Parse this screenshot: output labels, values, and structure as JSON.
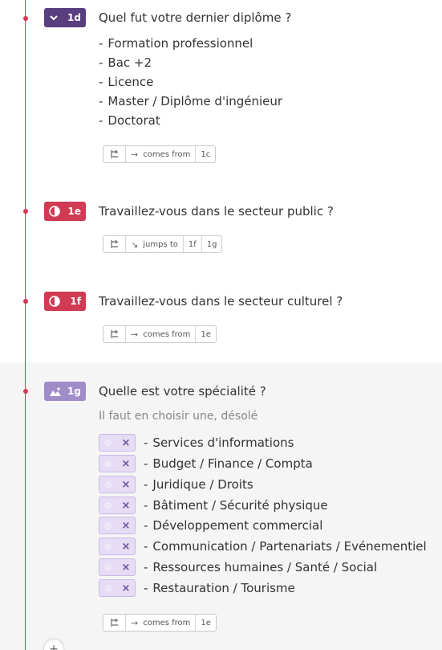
{
  "q1d": {
    "badge": "1d",
    "title": "Quel fut votre dernier diplôme ?",
    "options": [
      "Formation professionnel",
      "Bac +2",
      "Licence",
      "Master / Diplôme d'ingénieur",
      "Doctorat"
    ],
    "logic": {
      "relation": "comes from",
      "targets": [
        "1c"
      ]
    }
  },
  "q1e": {
    "badge": "1e",
    "title": "Travaillez-vous dans le secteur public ?",
    "logic": {
      "relation": "jumps to",
      "targets": [
        "1f",
        "1g"
      ]
    }
  },
  "q1f": {
    "badge": "1f",
    "title": "Travaillez-vous dans le secteur culturel ?",
    "logic": {
      "relation": "comes from",
      "targets": [
        "1e"
      ]
    }
  },
  "q1g": {
    "badge": "1g",
    "title": "Quelle est votre spécialité ?",
    "subtitle": "Il faut en choisir une, désolé",
    "options": [
      "Services d'informations",
      "Budget / Finance / Compta",
      "Juridique / Droits",
      "Bâtiment / Sécurité physique",
      "Développement commercial",
      "Communication / Partenariats / Evénementiel",
      "Ressources humaines / Santé / Social",
      "Restauration / Tourisme"
    ],
    "logic": {
      "relation": "comes from",
      "targets": [
        "1e"
      ]
    }
  },
  "dash": "-",
  "add_label": "+",
  "colors": {
    "accent": "#d03a52",
    "purple": "#5a3f80",
    "lilac": "#a08cc8"
  }
}
